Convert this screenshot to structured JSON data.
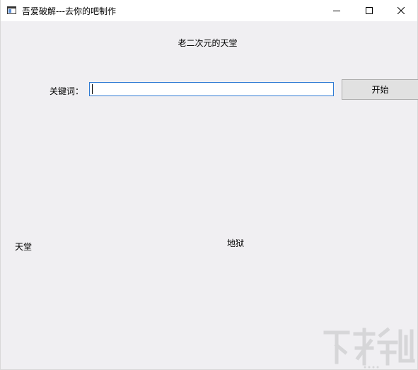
{
  "window": {
    "title": "吾爱破解---去你的吧制作",
    "controls": {
      "minimize_icon": "minimize-icon",
      "maximize_icon": "maximize-icon",
      "close_icon": "close-icon"
    }
  },
  "main": {
    "subtitle": "老二次元的天堂",
    "keyword_label": "关键词：",
    "keyword_value": "",
    "start_button": "开始",
    "heaven_label": "天堂",
    "hell_label": "地狱"
  },
  "colors": {
    "client_bg": "#f0eff2",
    "input_border": "#2f7bd4",
    "button_bg": "#e1e1e1"
  }
}
